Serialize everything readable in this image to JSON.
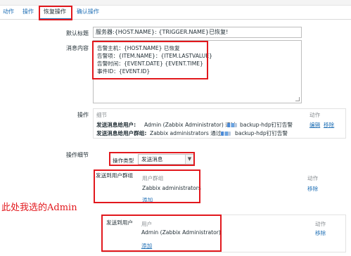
{
  "tabs": {
    "action": "动作",
    "operations": "操作",
    "recovery_operations": "恢复操作",
    "acknowledge_operations": "确认操作"
  },
  "form": {
    "default_subject_label": "默认标题",
    "default_subject_value": "服务器:{HOST.NAME}: {TRIGGER.NAME}已恢复!",
    "message_label": "消息内容",
    "message_lines": [
      "告警主机：{HOST.NAME} 已恢复",
      "告警项：{ITEM.NAME}：{ITEM.LASTVALUE}",
      "告警时间：{EVENT.DATE} {EVENT.TIME}",
      "事件ID：{EVENT.ID}"
    ],
    "operations_label": "操作",
    "operations_table": {
      "col_details": "细节",
      "col_action": "动作",
      "rows": [
        {
          "prefix": "发送消息给用户:",
          "text_before": "Admin (Zabbix Administrator) 通过",
          "text_after": "backup-hdp钉钉告警",
          "edit": "编辑",
          "remove": "移除"
        },
        {
          "prefix": "发送消息给用户群组:",
          "text_before": "Zabbix administrators 通过",
          "text_after": "backup-hdp钉钉告警"
        }
      ]
    },
    "op_details_label": "操作细节",
    "op_type_label": "操作类型",
    "op_type_value": "发送消息",
    "send_to_groups": {
      "label": "发送到用户群组",
      "col_group": "用户群组",
      "col_action": "动作",
      "item": "Zabbix administrators",
      "remove": "移除",
      "add": "添加"
    },
    "send_to_users": {
      "label": "发送到用户",
      "col_user": "用户",
      "col_action": "动作",
      "item": "Admin (Zabbix Administrator)",
      "remove": "移除",
      "add": "添加"
    }
  },
  "annotation": "此处我选的Admin",
  "colors": {
    "link": "#1f6fb5",
    "highlight": "#e2181d",
    "text": "#1f2c33"
  }
}
